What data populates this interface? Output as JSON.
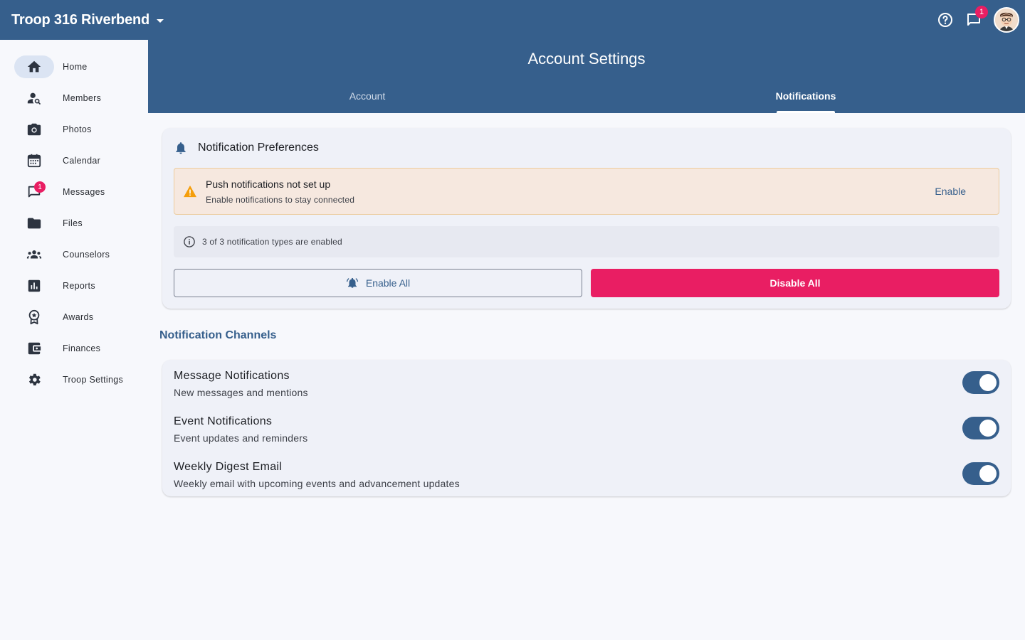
{
  "app": {
    "troop_name": "Troop 316 Riverbend",
    "messages_badge": "1"
  },
  "sidebar": {
    "items": [
      {
        "label": "Home",
        "icon": "home-icon"
      },
      {
        "label": "Members",
        "icon": "person-search-icon"
      },
      {
        "label": "Photos",
        "icon": "camera-icon"
      },
      {
        "label": "Calendar",
        "icon": "calendar-icon"
      },
      {
        "label": "Messages",
        "icon": "chat-icon",
        "badge": "1"
      },
      {
        "label": "Files",
        "icon": "folder-icon"
      },
      {
        "label": "Counselors",
        "icon": "groups-icon"
      },
      {
        "label": "Reports",
        "icon": "bar-chart-icon"
      },
      {
        "label": "Awards",
        "icon": "award-icon"
      },
      {
        "label": "Finances",
        "icon": "wallet-icon"
      },
      {
        "label": "Troop Settings",
        "icon": "gear-icon"
      }
    ],
    "active": "Home"
  },
  "header": {
    "title": "Account Settings",
    "tabs": [
      {
        "label": "Account"
      },
      {
        "label": "Notifications"
      }
    ],
    "active_tab": "Notifications"
  },
  "preferences": {
    "title": "Notification Preferences",
    "warning": {
      "title": "Push notifications not set up",
      "subtitle": "Enable notifications to stay connected",
      "action": "Enable"
    },
    "info": "3 of 3 notification types are enabled",
    "enable_all": "Enable All",
    "disable_all": "Disable All"
  },
  "channels": {
    "title": "Notification Channels",
    "items": [
      {
        "name": "Message Notifications",
        "description": "New messages and mentions",
        "enabled": true
      },
      {
        "name": "Event Notifications",
        "description": "Event updates and reminders",
        "enabled": true
      },
      {
        "name": "Weekly Digest Email",
        "description": "Weekly email with upcoming events and advancement updates",
        "enabled": true
      }
    ]
  },
  "colors": {
    "primary": "#365f8c",
    "accent": "#e91e63",
    "warning": "#f59e0b"
  }
}
